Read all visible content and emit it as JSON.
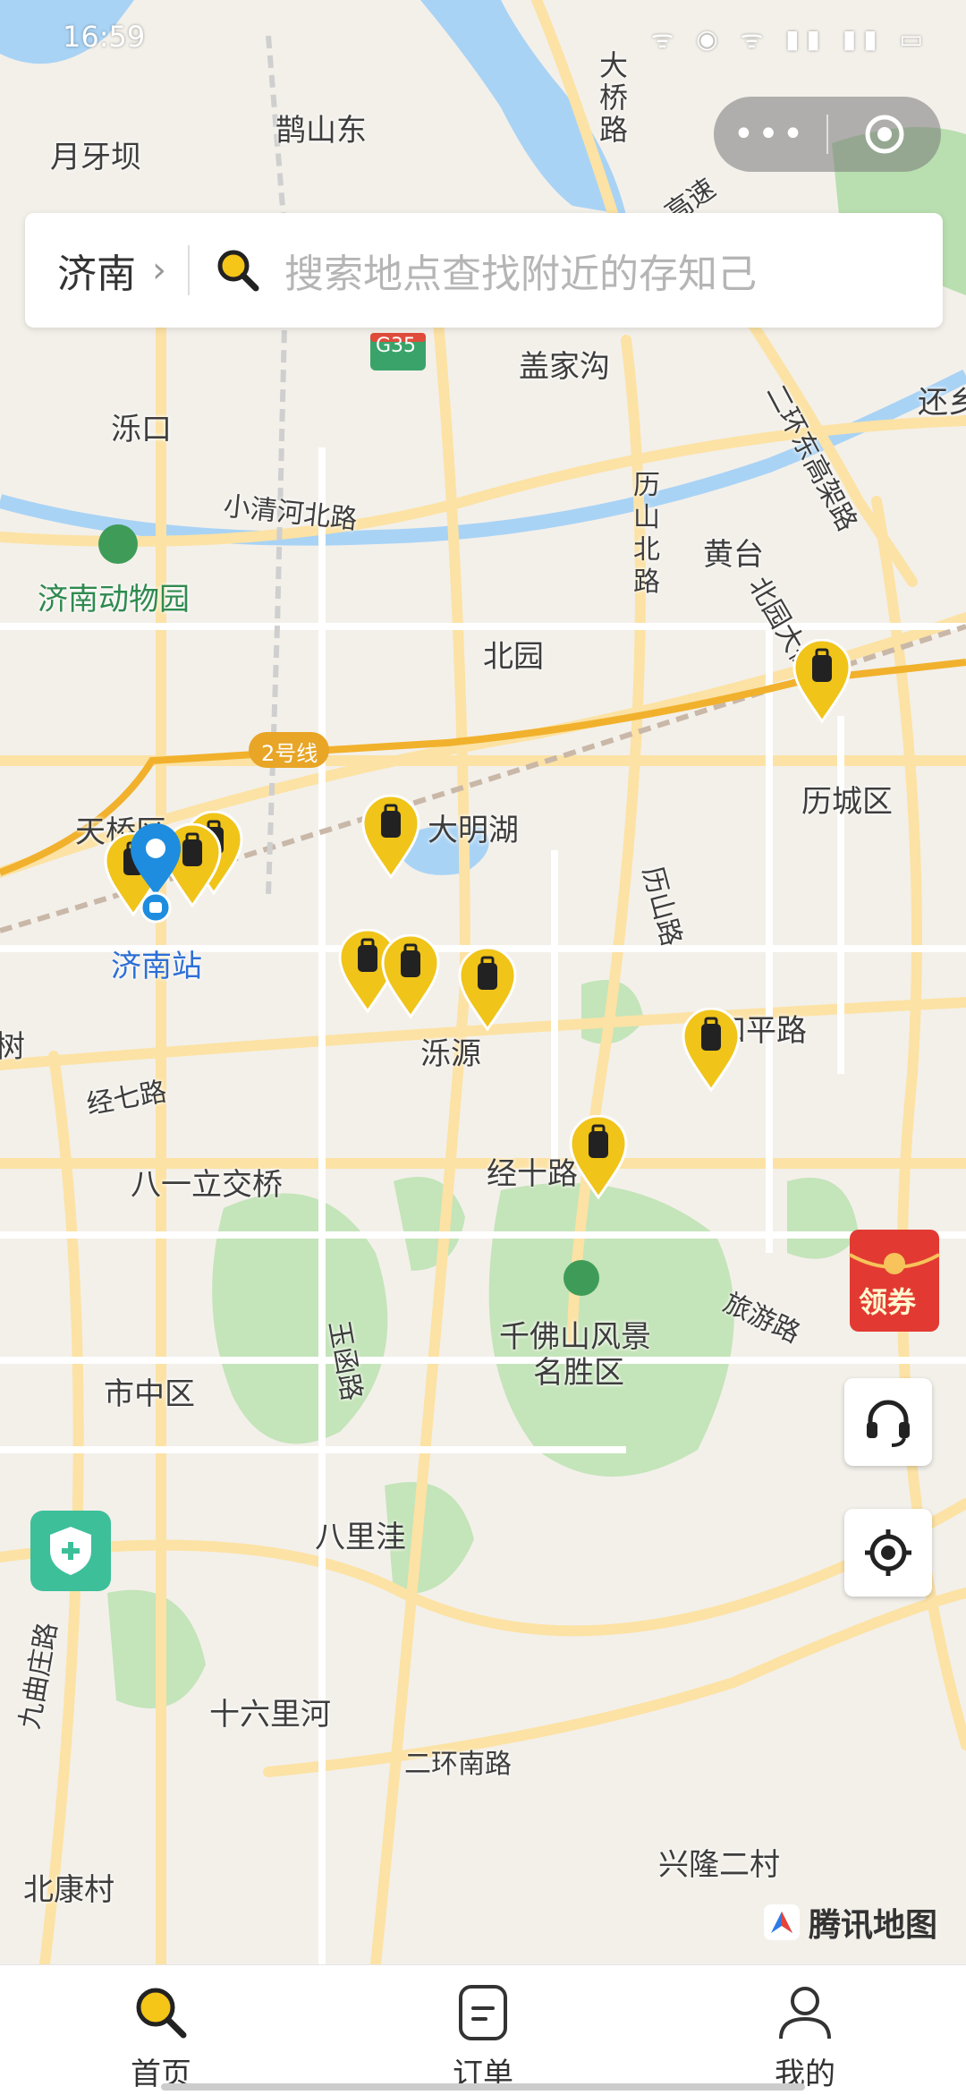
{
  "status_bar": {
    "time": "16:59",
    "indicators": "ᯤ ◉ ᯤ ▮▮ ▮▮ ▭"
  },
  "capsule": {
    "more_label": "•••"
  },
  "search": {
    "city": "济南",
    "chevron": "›",
    "placeholder": "搜索地点查找附近的存知己"
  },
  "map_labels": [
    {
      "text": "月牙坝"
    },
    {
      "text": "鹊山东"
    },
    {
      "text": "大桥路"
    },
    {
      "text": "盖家沟"
    },
    {
      "text": "泺口"
    },
    {
      "text": "小清河北路"
    },
    {
      "text": "济南动物园"
    },
    {
      "text": "历山北路"
    },
    {
      "text": "黄台"
    },
    {
      "text": "北园"
    },
    {
      "text": "北园大街"
    },
    {
      "text": "二环东高架路"
    },
    {
      "text": "历城区"
    },
    {
      "text": "天桥区"
    },
    {
      "text": "大明湖"
    },
    {
      "text": "济南站"
    },
    {
      "text": "历山路"
    },
    {
      "text": "和平路"
    },
    {
      "text": "泺源"
    },
    {
      "text": "经七路"
    },
    {
      "text": "八一立交桥"
    },
    {
      "text": "经十路"
    },
    {
      "text": "旅游路"
    },
    {
      "text": "千佛山风景"
    },
    {
      "text": "名胜区"
    },
    {
      "text": "市中区"
    },
    {
      "text": "玉函路"
    },
    {
      "text": "八里洼"
    },
    {
      "text": "九曲庄路"
    },
    {
      "text": "十六里河"
    },
    {
      "text": "二环南路"
    },
    {
      "text": "兴隆二村"
    },
    {
      "text": "北康村"
    },
    {
      "text": "G35"
    },
    {
      "text": "2号线"
    },
    {
      "text": "还乡"
    },
    {
      "text": "高速"
    },
    {
      "text": "树"
    }
  ],
  "floating": {
    "coupon_label": "领券"
  },
  "map_logo": {
    "text": "腾讯地图"
  },
  "tabs": [
    {
      "label": "首页",
      "icon": "search-icon"
    },
    {
      "label": "订单",
      "icon": "document-icon"
    },
    {
      "label": "我的",
      "icon": "person-icon"
    }
  ],
  "colors": {
    "pin": "#f0c419",
    "accent": "#f5c518",
    "park": "#b9dfb0",
    "water": "#a9d3f5",
    "road": "#fce2a4"
  }
}
